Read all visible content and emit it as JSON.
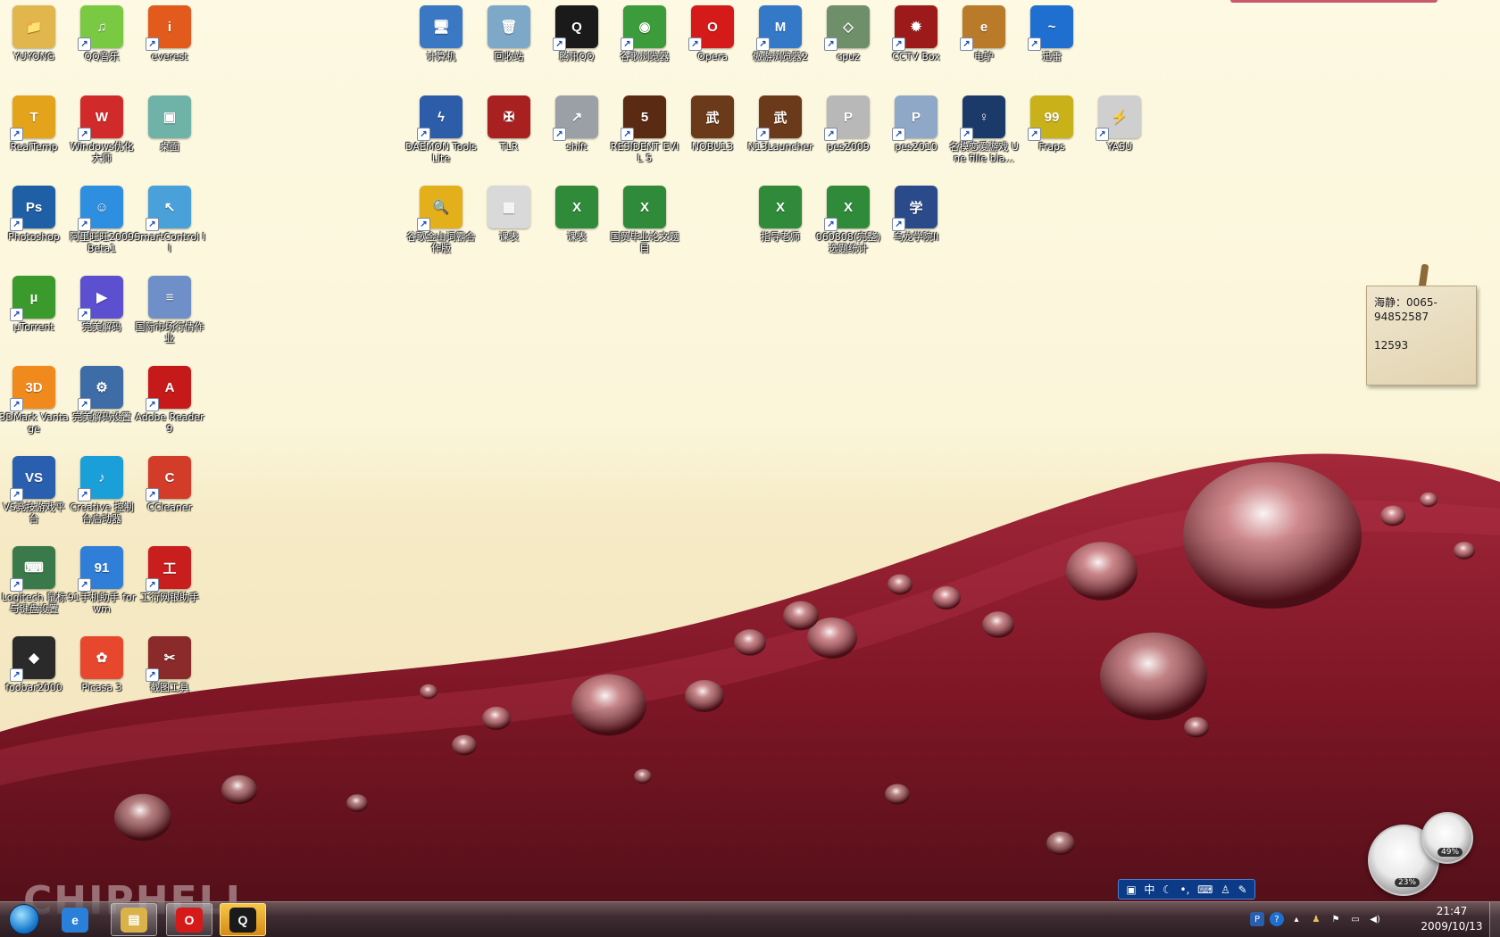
{
  "desktop": {
    "left_icons": [
      {
        "label": "YUYONG",
        "glyph": "📁",
        "color": "#e1b64c",
        "shortcut": false,
        "name": "icon-yuyong"
      },
      {
        "label": "QQ音乐",
        "glyph": "♫",
        "color": "#7ac943",
        "shortcut": true,
        "name": "icon-qq-music"
      },
      {
        "label": "everest",
        "glyph": "i",
        "color": "#e25b1c",
        "shortcut": true,
        "name": "icon-everest"
      },
      {
        "label": "RealTemp",
        "glyph": "T",
        "color": "#e3a31a",
        "shortcut": true,
        "name": "icon-realtemp"
      },
      {
        "label": "Windows优化大师",
        "glyph": "W",
        "color": "#d12a2a",
        "shortcut": true,
        "name": "icon-windows-optimizer"
      },
      {
        "label": "桌面",
        "glyph": "▣",
        "color": "#6fb3a8",
        "shortcut": false,
        "name": "icon-desktop-folder"
      },
      {
        "label": "Photoshop",
        "glyph": "Ps",
        "color": "#1f5fa5",
        "shortcut": true,
        "name": "icon-photoshop"
      },
      {
        "label": "阿里旺旺2009 Beta1",
        "glyph": "☺",
        "color": "#2e8ee0",
        "shortcut": true,
        "name": "icon-aliwangwang"
      },
      {
        "label": "SmartControl II",
        "glyph": "↖",
        "color": "#4aa0d8",
        "shortcut": true,
        "name": "icon-smartcontrol"
      },
      {
        "label": "µTorrent",
        "glyph": "µ",
        "color": "#3a9a2b",
        "shortcut": true,
        "name": "icon-utorrent"
      },
      {
        "label": "完美解码",
        "glyph": "▶",
        "color": "#5c4fd0",
        "shortcut": true,
        "name": "icon-wanmei-decoder"
      },
      {
        "label": "国际市场行情作业",
        "glyph": "≡",
        "color": "#6f8fc9",
        "shortcut": false,
        "name": "icon-doc-homework"
      },
      {
        "label": "3DMark Vantage",
        "glyph": "3D",
        "color": "#f08a1c",
        "shortcut": true,
        "name": "icon-3dmark"
      },
      {
        "label": "完美解码设置",
        "glyph": "⚙",
        "color": "#3d6ca6",
        "shortcut": true,
        "name": "icon-decoder-settings"
      },
      {
        "label": "Adobe Reader 9",
        "glyph": "A",
        "color": "#c61a1a",
        "shortcut": true,
        "name": "icon-adobe-reader"
      },
      {
        "label": "VS竞技游戏平台",
        "glyph": "VS",
        "color": "#2a5fb0",
        "shortcut": true,
        "name": "icon-vs-platform"
      },
      {
        "label": "Creative 控制台启动器",
        "glyph": "♪",
        "color": "#1a9fd8",
        "shortcut": true,
        "name": "icon-creative"
      },
      {
        "label": "CCleaner",
        "glyph": "C",
        "color": "#d43c2a",
        "shortcut": true,
        "name": "icon-ccleaner"
      },
      {
        "label": "Logitech 鼠标与键盘设置",
        "glyph": "⌨",
        "color": "#3a7a4a",
        "shortcut": true,
        "name": "icon-logitech"
      },
      {
        "label": "91手机助手 for wm",
        "glyph": "91",
        "color": "#2f7fd8",
        "shortcut": true,
        "name": "icon-91-assistant"
      },
      {
        "label": "工行网银助手",
        "glyph": "工",
        "color": "#c81e1e",
        "shortcut": true,
        "name": "icon-icbc"
      },
      {
        "label": "foobar2000",
        "glyph": "◆",
        "color": "#2a2a2a",
        "shortcut": true,
        "name": "icon-foobar"
      },
      {
        "label": "Picasa 3",
        "glyph": "✿",
        "color": "#e7482d",
        "shortcut": false,
        "name": "icon-picasa"
      },
      {
        "label": "截图工具",
        "glyph": "✂",
        "color": "#8a2a2a",
        "shortcut": true,
        "name": "icon-snipping-tool"
      }
    ],
    "top_icons": [
      {
        "label": "计算机",
        "glyph": "🖥",
        "color": "#3b78c4",
        "shortcut": false,
        "name": "icon-computer"
      },
      {
        "label": "回收站",
        "glyph": "🗑",
        "color": "#7da8c8",
        "shortcut": false,
        "name": "icon-recycle-bin"
      },
      {
        "label": "腾讯QQ",
        "glyph": "Q",
        "color": "#1a1a1a",
        "shortcut": true,
        "name": "icon-tencent-qq"
      },
      {
        "label": "谷歌浏览器",
        "glyph": "◉",
        "color": "#3c9b3a",
        "shortcut": true,
        "name": "icon-chrome"
      },
      {
        "label": "Opera",
        "glyph": "O",
        "color": "#d51a1a",
        "shortcut": true,
        "name": "icon-opera"
      },
      {
        "label": "傲游浏览器2",
        "glyph": "M",
        "color": "#3478c8",
        "shortcut": true,
        "name": "icon-maxthon"
      },
      {
        "label": "cpuz",
        "glyph": "◇",
        "color": "#6f8f6a",
        "shortcut": true,
        "name": "icon-cpuz"
      },
      {
        "label": "CCTV Box",
        "glyph": "✹",
        "color": "#9d1a1a",
        "shortcut": true,
        "name": "icon-cctv-box"
      },
      {
        "label": "电驴",
        "glyph": "e",
        "color": "#b97a2a",
        "shortcut": true,
        "name": "icon-emule"
      },
      {
        "label": "迅雷",
        "glyph": "~",
        "color": "#1f6fd0",
        "shortcut": true,
        "name": "icon-thunder"
      },
      {
        "label": "DAEMON Tools Lite",
        "glyph": "ϟ",
        "color": "#2d5da8",
        "shortcut": true,
        "name": "icon-daemon-tools"
      },
      {
        "label": "TLR",
        "glyph": "✠",
        "color": "#a82020",
        "shortcut": false,
        "name": "icon-tlr"
      },
      {
        "label": "shift",
        "glyph": "↗",
        "color": "#9aa0a6",
        "shortcut": true,
        "name": "icon-shift"
      },
      {
        "label": "RESIDENT EVIL 5",
        "glyph": "5",
        "color": "#5a2a12",
        "shortcut": true,
        "name": "icon-resident-evil"
      },
      {
        "label": "NOBU13",
        "glyph": "武",
        "color": "#6b3a1a",
        "shortcut": false,
        "name": "icon-nobu13"
      },
      {
        "label": "N13Launcher",
        "glyph": "武",
        "color": "#6b3a1a",
        "shortcut": true,
        "name": "icon-n13launcher"
      },
      {
        "label": "pes2009",
        "glyph": "P",
        "color": "#b8b8b8",
        "shortcut": true,
        "name": "icon-pes2009"
      },
      {
        "label": "pes2010",
        "glyph": "P",
        "color": "#8fa8c8",
        "shortcut": true,
        "name": "icon-pes2010"
      },
      {
        "label": "名模恋爱游戏 Une fille bla...",
        "glyph": "♀",
        "color": "#1b3a6a",
        "shortcut": true,
        "name": "icon-une-fille"
      },
      {
        "label": "Fraps",
        "glyph": "99",
        "color": "#c9b11a",
        "shortcut": true,
        "name": "icon-fraps"
      },
      {
        "label": "YASU",
        "glyph": "⚡",
        "color": "#cfcfcf",
        "shortcut": true,
        "name": "icon-yasu"
      },
      {
        "label": "谷歌金山词霸合作版",
        "glyph": "🔍",
        "color": "#e3b01c",
        "shortcut": true,
        "name": "icon-jinshan-ciba"
      },
      {
        "label": "课表",
        "glyph": "▦",
        "color": "#d9d9d9",
        "shortcut": false,
        "name": "icon-schedule-image"
      },
      {
        "label": "课表",
        "glyph": "X",
        "color": "#2f8a3a",
        "shortcut": false,
        "name": "icon-schedule-excel"
      },
      {
        "label": "国贸毕业论文题目",
        "glyph": "X",
        "color": "#2f8a3a",
        "shortcut": false,
        "name": "icon-thesis-topics"
      },
      {
        "label": "指导老师",
        "glyph": "X",
        "color": "#2f8a3a",
        "shortcut": false,
        "name": "icon-advisors"
      },
      {
        "label": "060808(完整)选题统计",
        "glyph": "X",
        "color": "#2f8a3a",
        "shortcut": true,
        "name": "icon-topic-stats"
      },
      {
        "label": "乌龙学院II",
        "glyph": "学",
        "color": "#2a4a8a",
        "shortcut": true,
        "name": "icon-wulong-academy"
      }
    ]
  },
  "sticky_note": {
    "line1": "海静：0065-",
    "line2": "94852587",
    "line3": "12593"
  },
  "gadgets": {
    "cpu_percent": "23%",
    "mem_percent": "49%"
  },
  "ime": {
    "mode": "中"
  },
  "watermark": "CHIPHELL",
  "taskbar": {
    "pinned": [
      {
        "name": "taskbar-ie",
        "glyph": "e",
        "color": "#2a7fd8"
      },
      {
        "name": "taskbar-explorer",
        "glyph": "▤",
        "color": "#d9b24a"
      },
      {
        "name": "taskbar-opera",
        "glyph": "O",
        "color": "#d51a1a"
      },
      {
        "name": "taskbar-qq",
        "glyph": "Q",
        "color": "#1a1a1a"
      }
    ],
    "clock_time": "21:47",
    "clock_date": "2009/10/13"
  }
}
